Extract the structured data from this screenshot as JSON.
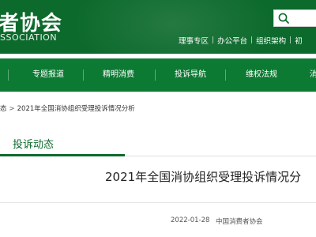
{
  "header": {
    "logo_cn": "者协会",
    "logo_en": "SSOCIATION",
    "search_placeholder": ""
  },
  "top_links": [
    "理事专区",
    "办公平台",
    "组织架构",
    "初"
  ],
  "top_link_separator": "|",
  "nav": {
    "items": [
      "专题报道",
      "精明消费",
      "投诉导航",
      "维权法规",
      "消"
    ]
  },
  "breadcrumb": {
    "parent": "态",
    "separator": ">",
    "current": "2021年全国消协组织受理投诉情况分析"
  },
  "section": {
    "title": "投诉动态"
  },
  "article": {
    "title": "2021年全国消协组织受理投诉情况分",
    "date": "2022-01-28",
    "source": "中国消费者协会"
  },
  "colors": {
    "header_bg": "#0c6a2c",
    "nav_bg": "#0d7a34",
    "accent": "#0c6a2c"
  }
}
